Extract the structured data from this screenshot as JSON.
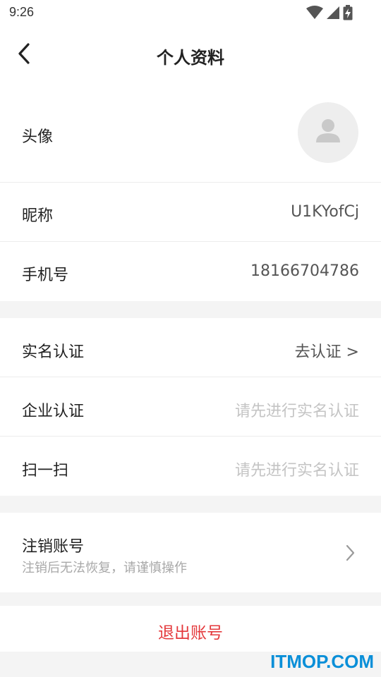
{
  "status_bar": {
    "time": "9:26"
  },
  "header": {
    "title": "个人资料"
  },
  "profile": {
    "avatar_label": "头像",
    "nickname_label": "昵称",
    "nickname_value": "U1KYofCj",
    "phone_label": "手机号",
    "phone_value": "18166704786"
  },
  "verification": {
    "realname_label": "实名认证",
    "realname_value": "去认证 >",
    "enterprise_label": "企业认证",
    "enterprise_value": "请先进行实名认证",
    "scan_label": "扫一扫",
    "scan_value": "请先进行实名认证"
  },
  "account": {
    "cancel_label": "注销账号",
    "cancel_hint": "注销后无法恢复，请谨慎操作",
    "logout_label": "退出账号"
  },
  "watermark": {
    "text": "ITMOP.COM"
  },
  "colors": {
    "accent_red": "#e4393c",
    "muted_text": "#c4c4c4",
    "watermark_blue": "#0a8fd8",
    "section_gap": "#f4f4f4"
  }
}
